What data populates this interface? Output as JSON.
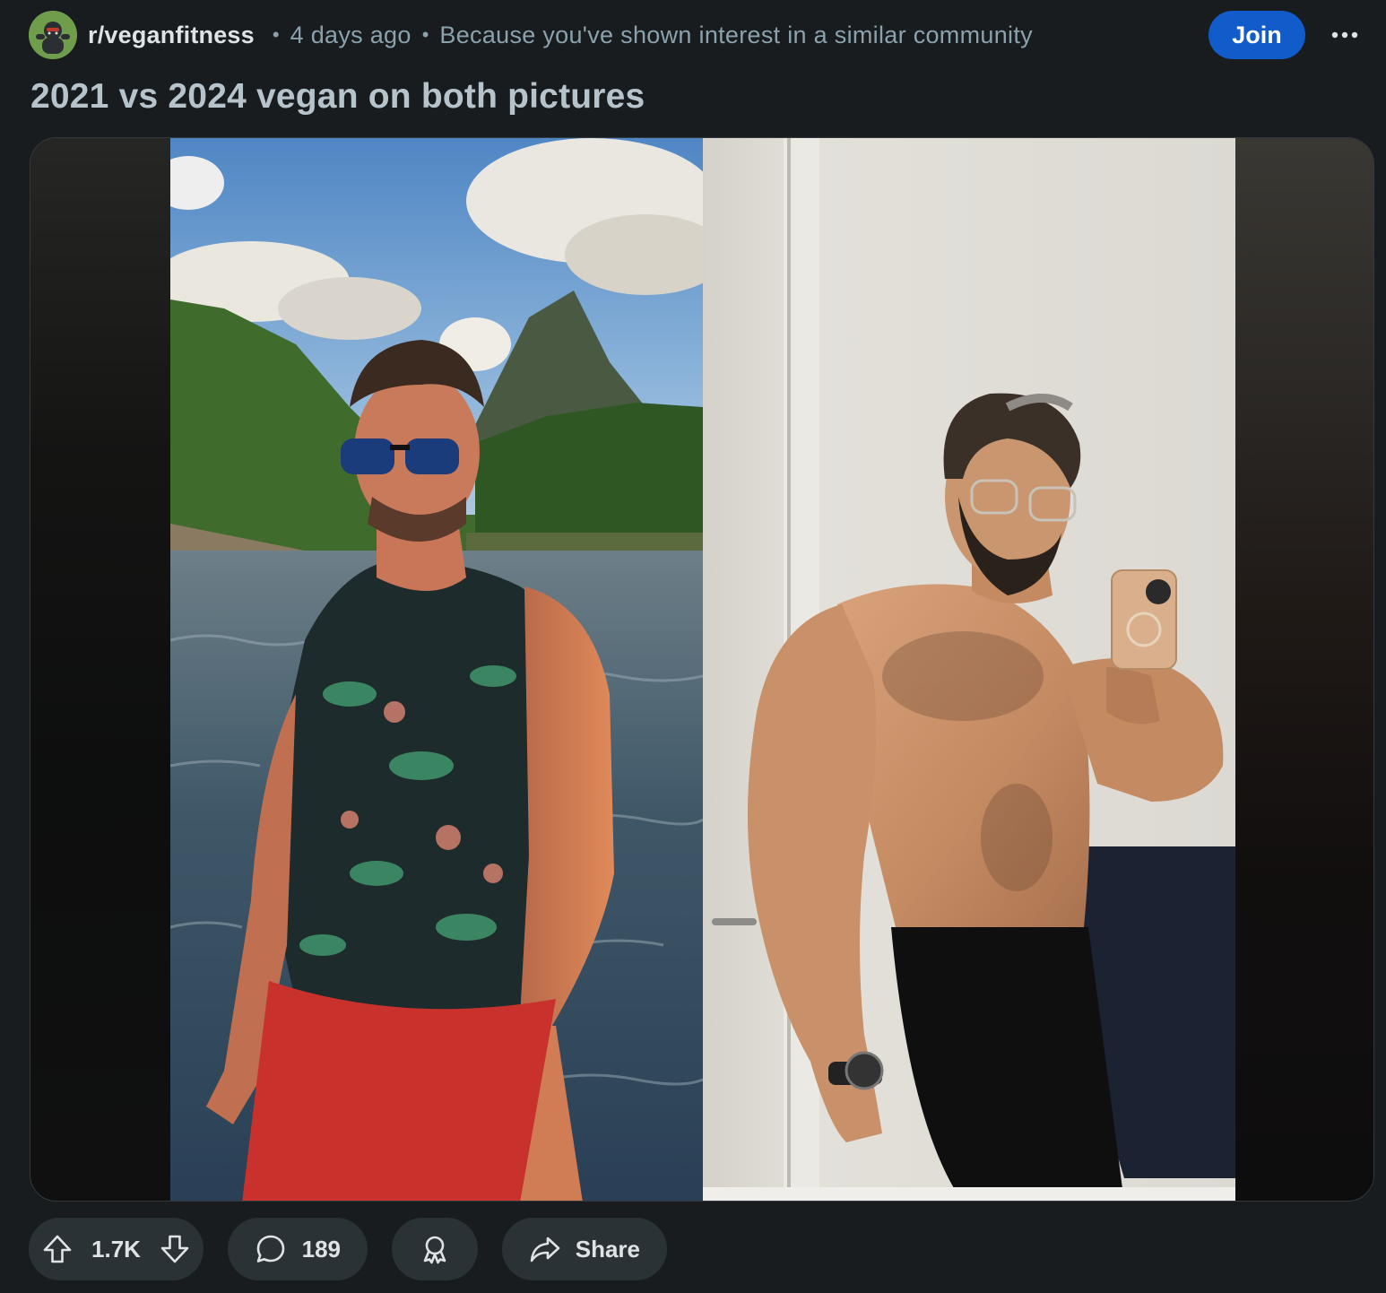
{
  "header": {
    "subreddit": "r/veganfitness",
    "time": "4 days ago",
    "reason": "Because you've shown interest in a similar community",
    "join_label": "Join",
    "more_icon": "more-dots-icon",
    "separator": "•"
  },
  "post": {
    "title": "2021 vs 2024 vegan on both pictures"
  },
  "actions": {
    "upvote_icon": "arrow-up-icon",
    "score": "1.7K",
    "downvote_icon": "arrow-down-icon",
    "comment_icon": "comment-bubble-icon",
    "comments": "189",
    "award_icon": "award-icon",
    "share_icon": "share-arrow-icon",
    "share_label": "Share"
  },
  "colors": {
    "background": "#181c1f",
    "join_button": "#115bca",
    "pill": "#2a3236",
    "meta_text": "#8ba2ad",
    "title_text": "#b7c3cb"
  }
}
